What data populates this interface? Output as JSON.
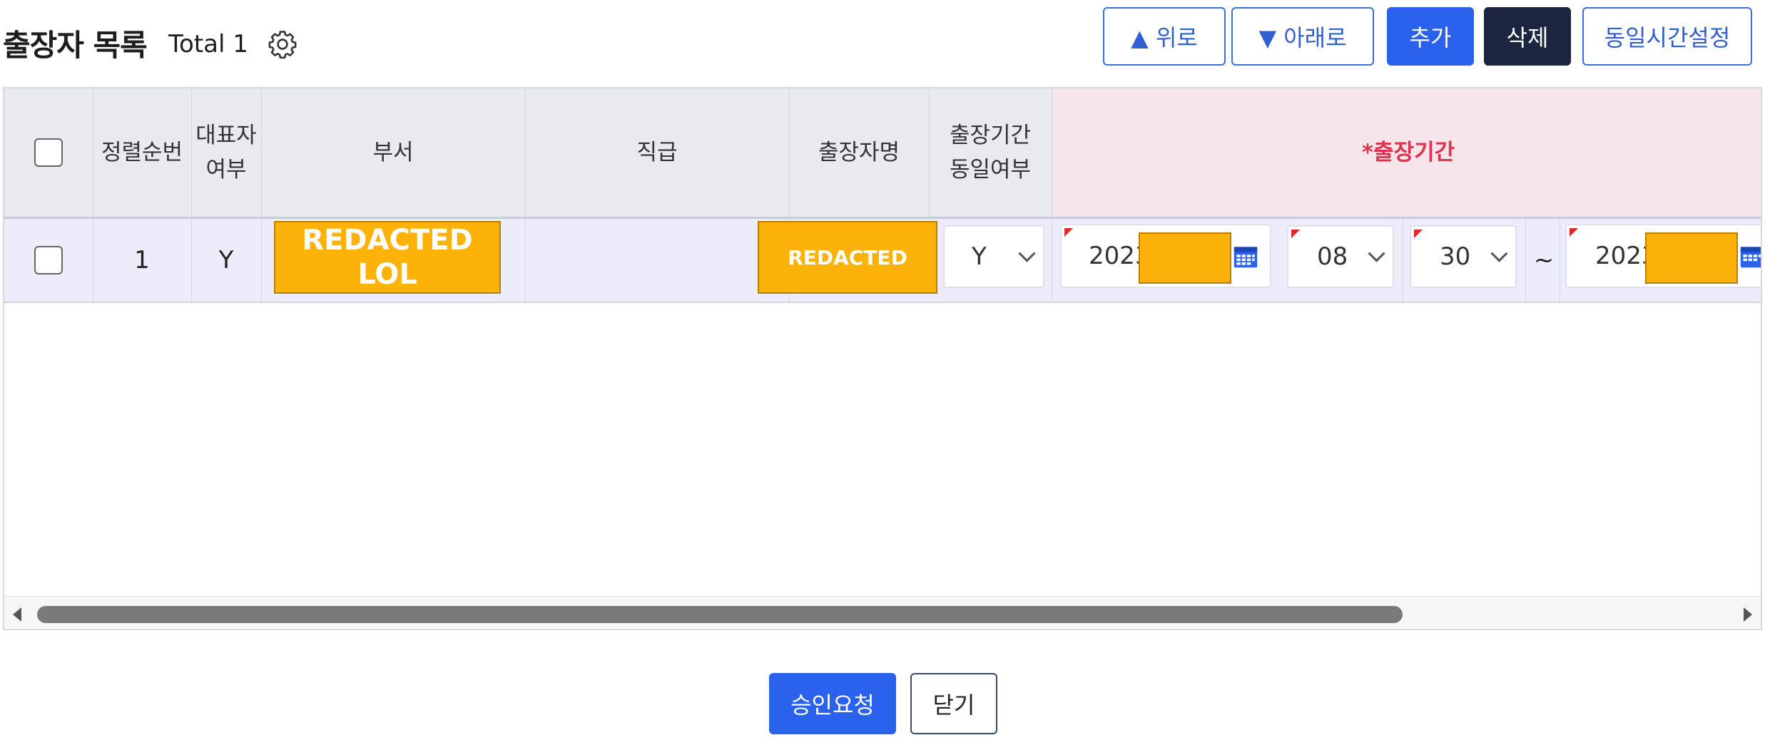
{
  "header": {
    "title": "출장자 목록",
    "total": "Total 1",
    "buttons": {
      "up": "▲ 위로",
      "down": "▼ 아래로",
      "add": "추가",
      "delete": "삭제",
      "same_time": "동일시간설정"
    }
  },
  "columns": {
    "sort_order": "정렬순번",
    "representative": [
      "대표자",
      "여부"
    ],
    "department": "부서",
    "position": "직급",
    "traveler_name": "출장자명",
    "same_period": [
      "출장기간",
      "동일여부"
    ],
    "period": "*출장기간"
  },
  "rows": [
    {
      "sort_order": "1",
      "representative": "Y",
      "department": "REDACTED LOL",
      "position": "",
      "traveler_name": "REDACTED",
      "same_period": "Y",
      "start_year": "2023",
      "start_month": "08",
      "start_day": "30",
      "separator": "~",
      "end_year": "2023"
    }
  ],
  "footer": {
    "approve": "승인요청",
    "close": "닫기"
  },
  "colors": {
    "accent_blue": "#2a62ee",
    "dark_button": "#1b2540",
    "required_red": "#e0334f",
    "redaction": "#fcb208"
  }
}
